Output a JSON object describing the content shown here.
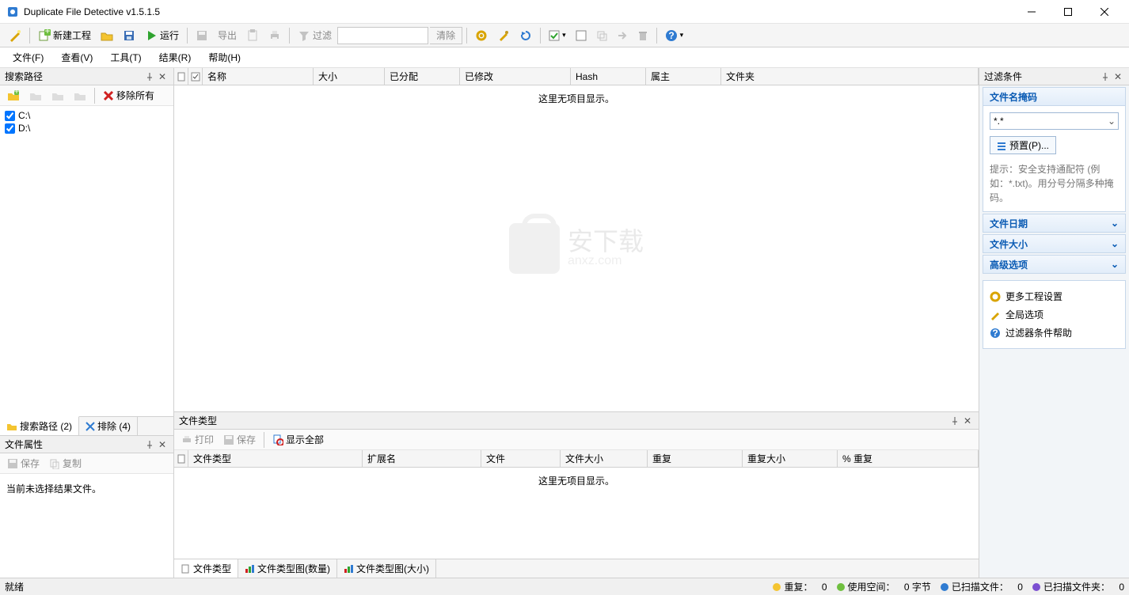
{
  "window": {
    "title": "Duplicate File Detective v1.5.1.5"
  },
  "toolbar": {
    "new_project": "新建工程",
    "run": "运行",
    "export": "导出",
    "filter": "过滤",
    "clear": "清除"
  },
  "menubar": {
    "file": "文件(F)",
    "view": "查看(V)",
    "tools": "工具(T)",
    "results": "结果(R)",
    "help": "帮助(H)"
  },
  "left": {
    "search_paths_title": "搜索路径",
    "remove_all": "移除所有",
    "paths": [
      {
        "label": "C:\\"
      },
      {
        "label": "D:\\"
      }
    ],
    "tab_search": "搜索路径 (2)",
    "tab_exclude": "排除 (4)",
    "attr_title": "文件属性",
    "attr_save": "保存",
    "attr_copy": "复制",
    "attr_empty": "当前未选择结果文件。"
  },
  "grid": {
    "cols": {
      "name": "名称",
      "size": "大小",
      "alloc": "已分配",
      "modified": "已修改",
      "hash": "Hash",
      "owner": "属主",
      "folder": "文件夹"
    },
    "empty": "这里无项目显示。"
  },
  "bottom": {
    "title": "文件类型",
    "print": "打印",
    "save": "保存",
    "show_all": "显示全部",
    "cols": {
      "type": "文件类型",
      "ext": "扩展名",
      "files": "文件",
      "fsize": "文件大小",
      "dup": "重复",
      "dsize": "重复大小",
      "pct": "% 重复"
    },
    "empty": "这里无项目显示。",
    "tab_type": "文件类型",
    "tab_chart_count": "文件类型图(数量)",
    "tab_chart_size": "文件类型图(大小)"
  },
  "right": {
    "panel_title": "过滤条件",
    "mask_title": "文件名掩码",
    "mask_value": "*.*",
    "preset": "预置(P)...",
    "hint": "提示：安全支持通配符 (例如：*.txt)。用分号分隔多种掩码。",
    "date_title": "文件日期",
    "size_title": "文件大小",
    "adv_title": "高级选项",
    "link_more": "更多工程设置",
    "link_global": "全局选项",
    "link_help": "过滤器条件帮助"
  },
  "status": {
    "ready": "就绪",
    "dup_label": "重复：",
    "dup_val": "0",
    "used_label": "使用空间：",
    "used_val": "0 字节",
    "scanned_files_label": "已扫描文件：",
    "scanned_files_val": "0",
    "scanned_folders_label": "已扫描文件夹：",
    "scanned_folders_val": "0"
  },
  "colors": {
    "dot_dup": "#f4c430",
    "dot_used": "#6fbf3f",
    "dot_files": "#2f7bd1",
    "dot_folders": "#7b4fd1"
  }
}
